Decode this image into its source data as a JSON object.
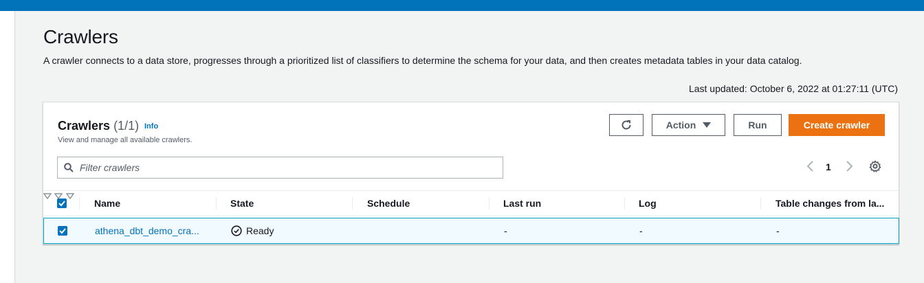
{
  "page": {
    "title": "Crawlers",
    "description": "A crawler connects to a data store, progresses through a prioritized list of classifiers to determine the schema for your data, and then creates metadata tables in your data catalog.",
    "last_updated": "Last updated: October 6, 2022 at 01:27:11 (UTC)"
  },
  "panel": {
    "title": "Crawlers",
    "count": "(1/1)",
    "info": "Info",
    "subtitle": "View and manage all available crawlers.",
    "buttons": {
      "refresh_icon": "refresh-icon",
      "action": "Action",
      "run": "Run",
      "create": "Create crawler"
    },
    "filter": {
      "placeholder": "Filter crawlers",
      "value": ""
    },
    "pagination": {
      "current_page": "1"
    }
  },
  "table": {
    "columns": [
      "Name",
      "State",
      "Schedule",
      "Last run",
      "Log",
      "Table changes from la..."
    ],
    "rows": [
      {
        "selected": true,
        "name": "athena_dbt_demo_cra...",
        "state": "Ready",
        "schedule": "",
        "last_run": "-",
        "log": "-",
        "table_changes": "-"
      }
    ]
  },
  "colors": {
    "brand_blue": "#0073bb",
    "primary_orange": "#ec7211",
    "selected_row_bg": "#f1faff",
    "selected_row_border": "#00a1c9"
  }
}
